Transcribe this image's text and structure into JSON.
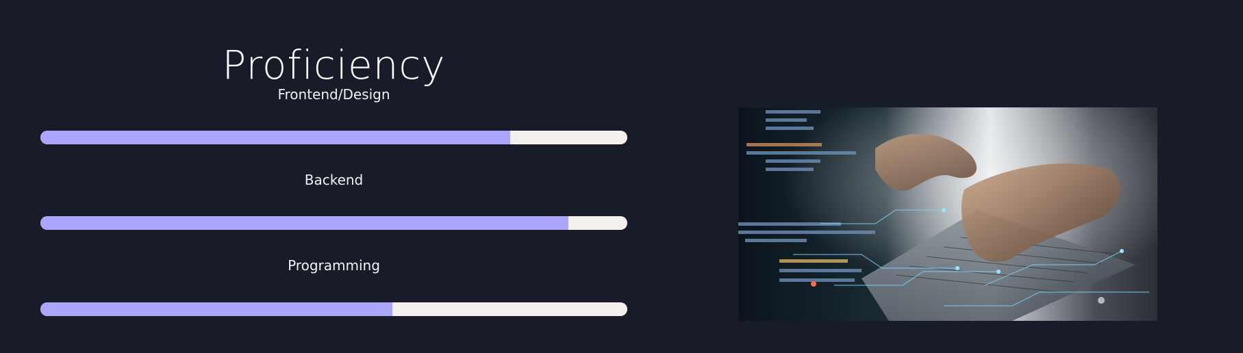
{
  "page": {
    "title": "Proficiency"
  },
  "skills": [
    {
      "label": "Frontend/Design",
      "level_percent": 80
    },
    {
      "label": "Backend",
      "level_percent": 90
    },
    {
      "label": "Programming",
      "level_percent": 60
    }
  ],
  "image": {
    "subject": "hands typing on laptop keyboard with code overlay"
  },
  "colors": {
    "background": "#181b28",
    "bar_fill": "#a9a6fb",
    "bar_track": "#f3f0ee",
    "text": "#ffffff"
  }
}
